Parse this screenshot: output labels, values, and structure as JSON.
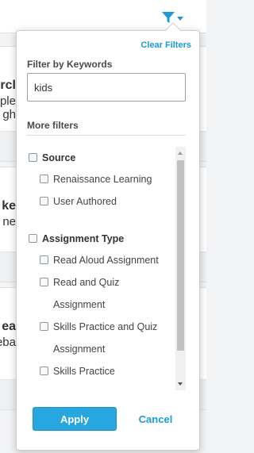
{
  "background": {
    "cards": [
      {
        "line1": "rcl",
        "line2": "ple",
        "line3": "gh"
      },
      {
        "line1": "ke",
        "line2": "ne"
      },
      {
        "line1": "ea",
        "line2": "eba"
      }
    ]
  },
  "filter_toggle": {
    "icon": "funnel-icon",
    "color": "#1a9ad6"
  },
  "panel": {
    "clear_filters": "Clear Filters",
    "keywords_label": "Filter by Keywords",
    "keywords_value": "kids",
    "more_filters_label": "More filters",
    "groups": [
      {
        "label": "Source",
        "checked": false,
        "options": [
          {
            "label": "Renaissance Learning",
            "checked": false
          },
          {
            "label": "User Authored",
            "checked": false
          }
        ]
      },
      {
        "label": "Assignment Type",
        "checked": false,
        "options": [
          {
            "label": "Read Aloud Assignment",
            "checked": false
          },
          {
            "label": "Read and Quiz Assignment",
            "checked": false
          },
          {
            "label": "Skills Practice and Quiz Assignment",
            "checked": false
          },
          {
            "label": "Skills Practice",
            "checked": false
          }
        ]
      }
    ],
    "apply_label": "Apply",
    "cancel_label": "Cancel"
  },
  "colors": {
    "accent": "#27a6e0",
    "link": "#1a9ad6"
  }
}
